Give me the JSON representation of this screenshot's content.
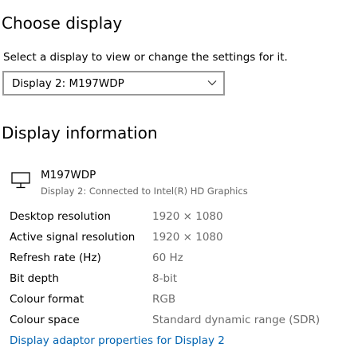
{
  "choose_display": {
    "title": "Choose display",
    "description": "Select a display to view or change the settings for it.",
    "select": {
      "value": "Display 2: M197WDP"
    }
  },
  "display_information": {
    "title": "Display information",
    "monitor": {
      "icon": "monitor-icon",
      "name": "M197WDP",
      "subtitle": "Display 2: Connected to Intel(R) HD Graphics"
    },
    "rows": [
      {
        "label": "Desktop resolution",
        "value": "1920 × 1080"
      },
      {
        "label": "Active signal resolution",
        "value": "1920 × 1080"
      },
      {
        "label": "Refresh rate (Hz)",
        "value": "60 Hz"
      },
      {
        "label": "Bit depth",
        "value": "8-bit"
      },
      {
        "label": "Colour format",
        "value": "RGB"
      },
      {
        "label": "Colour space",
        "value": "Standard dynamic range (SDR)"
      }
    ],
    "link": "Display adaptor properties for Display 2"
  },
  "colors": {
    "link": "#0063b1",
    "secondary_text": "#6b6b6b",
    "select_border": "#999999"
  }
}
